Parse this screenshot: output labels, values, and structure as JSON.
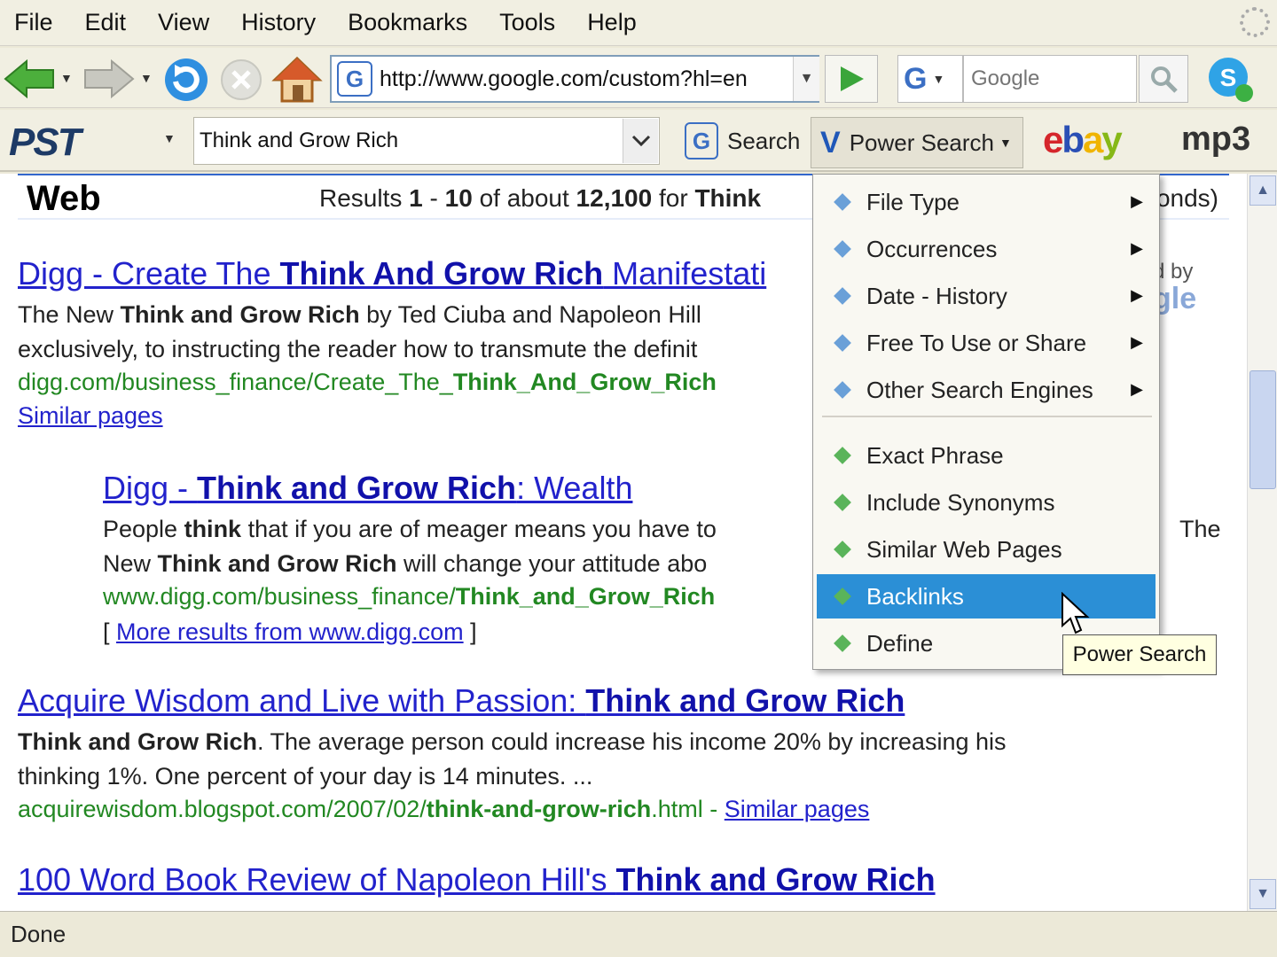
{
  "menubar": {
    "items": [
      "File",
      "Edit",
      "View",
      "History",
      "Bookmarks",
      "Tools",
      "Help"
    ]
  },
  "navbar": {
    "url": "http://www.google.com/custom?hl=en",
    "search_placeholder": "Google"
  },
  "pst_toolbar": {
    "logo": "PST",
    "query": "Think and Grow Rich",
    "search_label": "Search",
    "power_search_label": "Power Search",
    "ebay_letters": [
      "e",
      "b",
      "a",
      "y"
    ],
    "mp3_label": "mp3"
  },
  "results_header": {
    "section": "Web",
    "count_prefix": "Results",
    "range_start": "1",
    "range_end": "10",
    "of_about": "of about",
    "total": "12,100",
    "for": "for",
    "query_bold": "Think",
    "tail": "onds)"
  },
  "powered_by": {
    "line1": "d by",
    "line2": "gle"
  },
  "results": [
    {
      "title_pre": "Digg - Create The ",
      "title_bold": "Think And Grow Rich",
      "title_post": " Manifestati",
      "snippet1_pre": "The New ",
      "snippet1_bold": "Think and Grow Rich",
      "snippet1_post": " by Ted Ciuba and Napoleon Hill",
      "snippet2": "exclusively, to instructing the reader how to transmute the definit",
      "url_pre": "digg.com/business_finance/Create_The_",
      "url_bold": "Think_And_Grow_Rich",
      "similar": "Similar pages"
    },
    {
      "title_pre": "Digg - ",
      "title_bold": "Think and Grow Rich",
      "title_post": ": Wealth",
      "snippet1_pre": "People ",
      "snippet1_bold": "think",
      "snippet1_post": " that if you are of meager means you have to",
      "snippet1_tail": "The",
      "snippet2_pre": "New ",
      "snippet2_bold": "Think and Grow Rich",
      "snippet2_post": " will change your attitude abo",
      "url_pre": "www.digg.com/business_finance/",
      "url_bold": "Think_and_Grow_Rich",
      "more_open": "[ ",
      "more": "More results from www.digg.com",
      "more_close": " ]"
    },
    {
      "title_pre": "Acquire Wisdom and Live with Passion: ",
      "title_bold": "Think and Grow Rich",
      "snippet1_bold": "Think and Grow Rich",
      "snippet1_post": ". The average person could increase his income 20% by increasing his",
      "snippet2": "thinking 1%. One percent of your day is 14 minutes. ...",
      "url_pre": "acquirewisdom.blogspot.com/2007/02/",
      "url_bold": "think-and-grow-rich",
      "url_post": ".html - ",
      "similar": "Similar pages"
    },
    {
      "title_pre": "100 Word Book Review of Napoleon Hill's ",
      "title_bold": "Think and Grow Rich"
    }
  ],
  "power_menu": {
    "items": [
      {
        "label": "File Type",
        "submenu": true
      },
      {
        "label": "Occurrences",
        "submenu": true
      },
      {
        "label": "Date - History",
        "submenu": true
      },
      {
        "label": "Free To Use or Share",
        "submenu": true
      },
      {
        "label": "Other Search Engines",
        "submenu": true
      },
      {
        "label": "Exact Phrase",
        "submenu": false
      },
      {
        "label": "Include Synonyms",
        "submenu": false
      },
      {
        "label": "Similar Web Pages",
        "submenu": false
      },
      {
        "label": "Backlinks",
        "submenu": false,
        "highlighted": true
      },
      {
        "label": "Define",
        "submenu": false
      }
    ],
    "submenu_arrow": "▶"
  },
  "tooltip": "Power Search",
  "statusbar": {
    "text": "Done"
  },
  "colors": {
    "link": "#2222cc",
    "url_green": "#228822",
    "highlight": "#2b8fd6",
    "chrome": "#f1efe2"
  },
  "icons": {
    "back": "back-arrow-icon",
    "forward": "forward-arrow-icon",
    "reload": "reload-icon",
    "stop": "stop-icon",
    "home": "home-icon",
    "go": "go-arrow-icon",
    "search": "magnifier-icon",
    "skype": "skype-icon",
    "cursor": "mouse-pointer-icon"
  }
}
